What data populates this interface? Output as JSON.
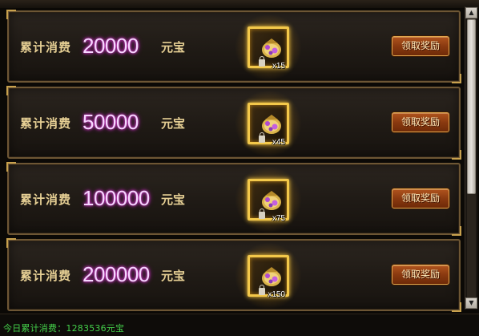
{
  "rewards": [
    {
      "label": "累计消费",
      "amount": "20000",
      "unit": "元宝",
      "item_icon": "gift-bag-icon",
      "quantity": "x15",
      "claim_label": "领取奖励"
    },
    {
      "label": "累计消费",
      "amount": "50000",
      "unit": "元宝",
      "item_icon": "gift-bag-icon",
      "quantity": "x45",
      "claim_label": "领取奖励"
    },
    {
      "label": "累计消费",
      "amount": "100000",
      "unit": "元宝",
      "item_icon": "gift-bag-icon",
      "quantity": "x75",
      "claim_label": "领取奖励"
    },
    {
      "label": "累计消费",
      "amount": "200000",
      "unit": "元宝",
      "item_icon": "gift-bag-icon",
      "quantity": "x150",
      "claim_label": "领取奖励"
    }
  ],
  "footer": {
    "today_spend": "今日累计消费：1283536元宝"
  },
  "colors": {
    "accent_gold": "#e6cf94",
    "amount_pink": "#f6d5ff",
    "footer_green": "#44d04a",
    "button_orange": "#8a3a10"
  }
}
